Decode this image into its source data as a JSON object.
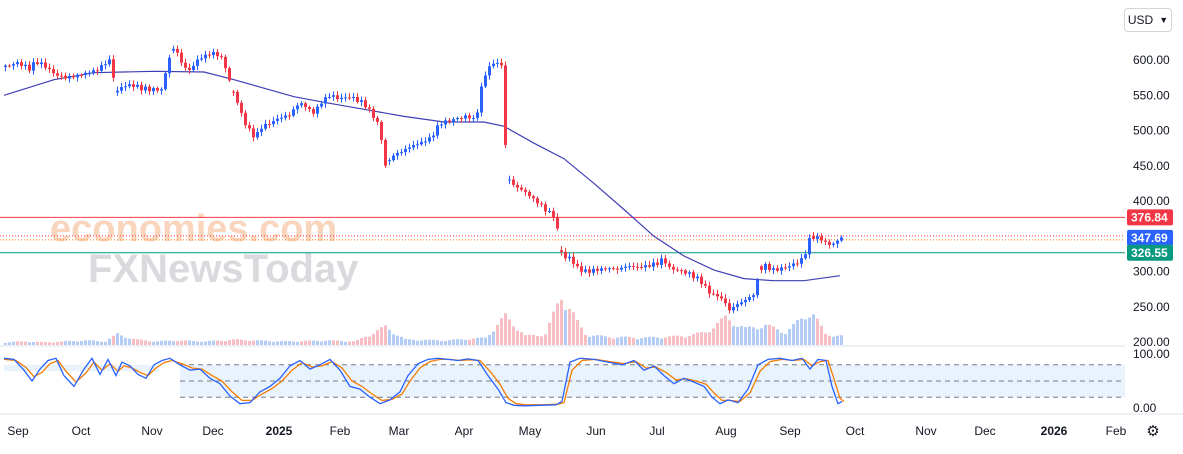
{
  "currency": {
    "label": "USD"
  },
  "watermark": {
    "line1": "economies.com",
    "line2": "FXNewsToday"
  },
  "colors": {
    "up": "#2962ff",
    "down": "#f23645",
    "resistance": "#f23645",
    "support": "#089981",
    "ma": "#3f3fb5",
    "stoch_k": "#2962ff",
    "stoch_d": "#f57c00"
  },
  "chart_data": {
    "type": "candlestick",
    "y_ticks": [
      "600.00",
      "550.00",
      "500.00",
      "450.00",
      "400.00",
      "350.00",
      "300.00",
      "250.00",
      "200.00"
    ],
    "ylim": [
      200,
      620
    ],
    "x_ticks": [
      "Sep",
      "Oct",
      "Nov",
      "Dec",
      "2025",
      "Feb",
      "Mar",
      "Apr",
      "May",
      "Jun",
      "Jul",
      "Aug",
      "Sep",
      "Oct",
      "Nov",
      "Dec",
      "2026",
      "Feb"
    ],
    "levels": [
      {
        "label": "376.84",
        "value": 376.84,
        "color": "#f23645"
      },
      {
        "label": "347.69",
        "value": 347.69,
        "color": "#2962ff"
      },
      {
        "label": "326.55",
        "value": 326.55,
        "color": "#089981"
      }
    ],
    "price_path": [
      [
        0,
        590
      ],
      [
        14,
        596
      ],
      [
        26,
        588
      ],
      [
        33,
        598
      ],
      [
        43,
        590
      ],
      [
        51,
        580
      ],
      [
        61,
        575
      ],
      [
        72,
        577
      ],
      [
        84,
        582
      ],
      [
        94,
        586
      ],
      [
        100,
        594
      ],
      [
        108,
        601
      ],
      [
        112,
        552
      ],
      [
        118,
        562
      ],
      [
        128,
        565
      ],
      [
        138,
        560
      ],
      [
        148,
        558
      ],
      [
        158,
        558
      ],
      [
        166,
        604
      ],
      [
        172,
        620
      ],
      [
        178,
        595
      ],
      [
        186,
        585
      ],
      [
        194,
        600
      ],
      [
        204,
        608
      ],
      [
        212,
        610
      ],
      [
        220,
        600
      ],
      [
        226,
        570
      ],
      [
        234,
        540
      ],
      [
        240,
        515
      ],
      [
        246,
        500
      ],
      [
        252,
        490
      ],
      [
        258,
        505
      ],
      [
        266,
        510
      ],
      [
        276,
        518
      ],
      [
        286,
        522
      ],
      [
        296,
        540
      ],
      [
        304,
        532
      ],
      [
        310,
        525
      ],
      [
        318,
        540
      ],
      [
        326,
        550
      ],
      [
        336,
        545
      ],
      [
        346,
        548
      ],
      [
        356,
        542
      ],
      [
        362,
        536
      ],
      [
        370,
        520
      ],
      [
        376,
        506
      ],
      [
        382,
        450
      ],
      [
        390,
        465
      ],
      [
        398,
        470
      ],
      [
        408,
        478
      ],
      [
        418,
        483
      ],
      [
        428,
        490
      ],
      [
        436,
        510
      ],
      [
        446,
        514
      ],
      [
        456,
        518
      ],
      [
        466,
        520
      ],
      [
        472,
        512
      ],
      [
        476,
        545
      ],
      [
        480,
        575
      ],
      [
        486,
        590
      ],
      [
        492,
        598
      ],
      [
        500,
        590
      ],
      [
        502,
        480
      ],
      [
        506,
        430
      ],
      [
        512,
        420
      ],
      [
        520,
        415
      ],
      [
        528,
        405
      ],
      [
        536,
        396
      ],
      [
        544,
        385
      ],
      [
        552,
        378
      ],
      [
        556,
        340
      ],
      [
        560,
        318
      ],
      [
        566,
        320
      ],
      [
        574,
        305
      ],
      [
        582,
        300
      ],
      [
        592,
        302
      ],
      [
        604,
        305
      ],
      [
        614,
        303
      ],
      [
        624,
        308
      ],
      [
        634,
        306
      ],
      [
        644,
        308
      ],
      [
        654,
        312
      ],
      [
        660,
        318
      ],
      [
        666,
        305
      ],
      [
        674,
        302
      ],
      [
        684,
        298
      ],
      [
        694,
        290
      ],
      [
        700,
        282
      ],
      [
        706,
        270
      ],
      [
        714,
        265
      ],
      [
        720,
        260
      ],
      [
        726,
        245
      ],
      [
        732,
        252
      ],
      [
        740,
        258
      ],
      [
        748,
        265
      ],
      [
        752,
        270
      ],
      [
        756,
        303
      ],
      [
        762,
        308
      ],
      [
        770,
        302
      ],
      [
        780,
        305
      ],
      [
        790,
        310
      ],
      [
        800,
        318
      ],
      [
        806,
        345
      ],
      [
        812,
        350
      ],
      [
        818,
        345
      ],
      [
        826,
        338
      ],
      [
        832,
        340
      ],
      [
        836,
        348
      ]
    ],
    "moving_average": [
      [
        0,
        550
      ],
      [
        50,
        572
      ],
      [
        90,
        582
      ],
      [
        150,
        584
      ],
      [
        200,
        583
      ],
      [
        230,
        572
      ],
      [
        260,
        560
      ],
      [
        290,
        548
      ],
      [
        320,
        540
      ],
      [
        360,
        530
      ],
      [
        400,
        520
      ],
      [
        440,
        512
      ],
      [
        480,
        512
      ],
      [
        500,
        506
      ],
      [
        530,
        482
      ],
      [
        560,
        460
      ],
      [
        590,
        425
      ],
      [
        620,
        388
      ],
      [
        650,
        350
      ],
      [
        680,
        322
      ],
      [
        710,
        302
      ],
      [
        740,
        290
      ],
      [
        770,
        287
      ],
      [
        800,
        287
      ],
      [
        836,
        294
      ]
    ],
    "volume": [
      [
        0,
        3
      ],
      [
        20,
        4
      ],
      [
        40,
        3
      ],
      [
        60,
        4
      ],
      [
        80,
        5
      ],
      [
        100,
        4
      ],
      [
        112,
        12
      ],
      [
        130,
        6
      ],
      [
        150,
        4
      ],
      [
        170,
        5
      ],
      [
        200,
        4
      ],
      [
        230,
        6
      ],
      [
        250,
        5
      ],
      [
        280,
        4
      ],
      [
        320,
        5
      ],
      [
        350,
        4
      ],
      [
        380,
        20
      ],
      [
        400,
        6
      ],
      [
        440,
        5
      ],
      [
        480,
        8
      ],
      [
        500,
        32
      ],
      [
        520,
        10
      ],
      [
        540,
        12
      ],
      [
        556,
        55
      ],
      [
        560,
        48
      ],
      [
        566,
        38
      ],
      [
        572,
        25
      ],
      [
        580,
        12
      ],
      [
        600,
        9
      ],
      [
        640,
        8
      ],
      [
        680,
        10
      ],
      [
        700,
        14
      ],
      [
        720,
        30
      ],
      [
        740,
        18
      ],
      [
        760,
        22
      ],
      [
        780,
        14
      ],
      [
        806,
        38
      ],
      [
        820,
        12
      ],
      [
        836,
        10
      ]
    ],
    "stochastic": {
      "ylim": [
        0,
        100
      ],
      "y_ticks": [
        "100.00",
        "0.00"
      ],
      "upper_band": 80,
      "lower_band": 20,
      "k_path": [
        [
          0,
          92
        ],
        [
          10,
          90
        ],
        [
          20,
          70
        ],
        [
          28,
          50
        ],
        [
          36,
          72
        ],
        [
          44,
          88
        ],
        [
          52,
          92
        ],
        [
          60,
          60
        ],
        [
          70,
          40
        ],
        [
          80,
          72
        ],
        [
          88,
          92
        ],
        [
          96,
          62
        ],
        [
          104,
          90
        ],
        [
          112,
          60
        ],
        [
          118,
          85
        ],
        [
          126,
          78
        ],
        [
          134,
          62
        ],
        [
          142,
          55
        ],
        [
          150,
          80
        ],
        [
          158,
          88
        ],
        [
          166,
          92
        ],
        [
          176,
          80
        ],
        [
          186,
          70
        ],
        [
          196,
          72
        ],
        [
          206,
          55
        ],
        [
          216,
          45
        ],
        [
          226,
          22
        ],
        [
          236,
          8
        ],
        [
          246,
          10
        ],
        [
          256,
          30
        ],
        [
          266,
          40
        ],
        [
          276,
          55
        ],
        [
          286,
          78
        ],
        [
          296,
          88
        ],
        [
          306,
          72
        ],
        [
          316,
          80
        ],
        [
          326,
          90
        ],
        [
          336,
          70
        ],
        [
          346,
          40
        ],
        [
          356,
          35
        ],
        [
          366,
          20
        ],
        [
          376,
          8
        ],
        [
          386,
          15
        ],
        [
          396,
          30
        ],
        [
          404,
          60
        ],
        [
          414,
          82
        ],
        [
          424,
          90
        ],
        [
          434,
          92
        ],
        [
          444,
          90
        ],
        [
          454,
          88
        ],
        [
          464,
          91
        ],
        [
          474,
          88
        ],
        [
          484,
          60
        ],
        [
          494,
          35
        ],
        [
          502,
          10
        ],
        [
          510,
          5
        ],
        [
          520,
          4
        ],
        [
          536,
          5
        ],
        [
          552,
          6
        ],
        [
          558,
          12
        ],
        [
          566,
          85
        ],
        [
          576,
          92
        ],
        [
          590,
          90
        ],
        [
          604,
          85
        ],
        [
          618,
          80
        ],
        [
          630,
          88
        ],
        [
          640,
          70
        ],
        [
          650,
          78
        ],
        [
          660,
          60
        ],
        [
          670,
          45
        ],
        [
          680,
          55
        ],
        [
          690,
          48
        ],
        [
          700,
          40
        ],
        [
          708,
          20
        ],
        [
          716,
          8
        ],
        [
          724,
          15
        ],
        [
          734,
          10
        ],
        [
          744,
          35
        ],
        [
          754,
          80
        ],
        [
          764,
          90
        ],
        [
          776,
          92
        ],
        [
          788,
          88
        ],
        [
          798,
          92
        ],
        [
          806,
          72
        ],
        [
          814,
          90
        ],
        [
          822,
          88
        ],
        [
          828,
          40
        ],
        [
          834,
          8
        ],
        [
          838,
          12
        ]
      ],
      "d_path": [
        [
          0,
          90
        ],
        [
          12,
          88
        ],
        [
          22,
          75
        ],
        [
          30,
          58
        ],
        [
          38,
          66
        ],
        [
          46,
          82
        ],
        [
          54,
          88
        ],
        [
          62,
          68
        ],
        [
          72,
          48
        ],
        [
          82,
          65
        ],
        [
          90,
          85
        ],
        [
          98,
          70
        ],
        [
          106,
          82
        ],
        [
          114,
          68
        ],
        [
          120,
          78
        ],
        [
          128,
          74
        ],
        [
          136,
          66
        ],
        [
          144,
          60
        ],
        [
          152,
          74
        ],
        [
          160,
          84
        ],
        [
          168,
          88
        ],
        [
          178,
          82
        ],
        [
          188,
          74
        ],
        [
          198,
          72
        ],
        [
          208,
          60
        ],
        [
          218,
          50
        ],
        [
          228,
          30
        ],
        [
          238,
          14
        ],
        [
          248,
          14
        ],
        [
          258,
          26
        ],
        [
          268,
          36
        ],
        [
          278,
          50
        ],
        [
          288,
          70
        ],
        [
          298,
          84
        ],
        [
          308,
          76
        ],
        [
          318,
          78
        ],
        [
          328,
          86
        ],
        [
          338,
          74
        ],
        [
          348,
          50
        ],
        [
          358,
          40
        ],
        [
          368,
          26
        ],
        [
          378,
          14
        ],
        [
          388,
          16
        ],
        [
          398,
          26
        ],
        [
          406,
          50
        ],
        [
          416,
          74
        ],
        [
          426,
          86
        ],
        [
          436,
          90
        ],
        [
          446,
          90
        ],
        [
          456,
          88
        ],
        [
          466,
          89
        ],
        [
          476,
          88
        ],
        [
          486,
          68
        ],
        [
          496,
          44
        ],
        [
          504,
          18
        ],
        [
          512,
          8
        ],
        [
          522,
          6
        ],
        [
          538,
          6
        ],
        [
          554,
          7
        ],
        [
          560,
          10
        ],
        [
          568,
          70
        ],
        [
          578,
          88
        ],
        [
          592,
          90
        ],
        [
          606,
          86
        ],
        [
          620,
          82
        ],
        [
          632,
          86
        ],
        [
          642,
          74
        ],
        [
          652,
          76
        ],
        [
          662,
          66
        ],
        [
          672,
          52
        ],
        [
          682,
          54
        ],
        [
          692,
          50
        ],
        [
          702,
          44
        ],
        [
          710,
          28
        ],
        [
          718,
          14
        ],
        [
          726,
          14
        ],
        [
          736,
          12
        ],
        [
          746,
          28
        ],
        [
          756,
          68
        ],
        [
          766,
          86
        ],
        [
          778,
          90
        ],
        [
          790,
          88
        ],
        [
          800,
          90
        ],
        [
          808,
          78
        ],
        [
          816,
          86
        ],
        [
          824,
          88
        ],
        [
          830,
          54
        ],
        [
          836,
          18
        ],
        [
          840,
          12
        ]
      ]
    }
  }
}
